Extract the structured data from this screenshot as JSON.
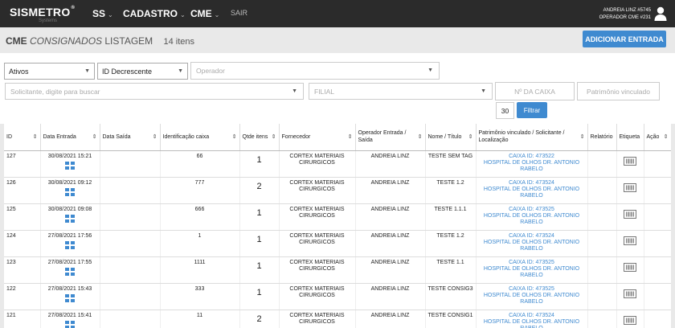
{
  "navbar": {
    "brand": "SISMETRO",
    "brand_sup": "®",
    "brand_sub": "Systems",
    "menu": [
      {
        "label": "SS"
      },
      {
        "label": "CADASTRO"
      },
      {
        "label": "CME"
      }
    ],
    "sair": "SAIR",
    "user_line1": "ANDREIA LINZ #5745",
    "user_line2": "OPERADOR CME #231"
  },
  "header": {
    "title_bold": "CME",
    "title_italic": "CONSIGNADOS",
    "title_rest": "LISTAGEM",
    "count": "14 itens",
    "add_button": "ADICIONAR ENTRADA"
  },
  "filters": {
    "status": "Ativos",
    "order": "ID Decrescente",
    "operador_placeholder": "Operador",
    "solicitante_placeholder": "Solicitante, digite para buscar",
    "filial_placeholder": "FILIAL",
    "caixa_placeholder": "Nº DA CAIXA",
    "patrimonio_placeholder": "Patrimônio vinculado",
    "page_size": "30",
    "filter_button": "Filtrar"
  },
  "table": {
    "headers": [
      "ID",
      "Data Entrada",
      "Data Saída",
      "Identificação caixa",
      "Qtde itens",
      "Fornecedor",
      "Operador Entrada / Saída",
      "Nome / Título",
      "Patrimônio vinculado / Solicitante / Localização",
      "Relatório",
      "Etiqueta",
      "Ação"
    ],
    "rows": [
      {
        "id": "127",
        "data_entrada": "30/08/2021 15:21",
        "data_saida": "",
        "caixa": "66",
        "qtde": "1",
        "fornecedor": "CORTEX MATERIAIS CIRURGICOS",
        "operador": "ANDREIA LINZ",
        "nome": "TESTE SEM TAG",
        "patrimonio": "CAIXA ID: 473522",
        "local": "HOSPITAL DE OLHOS DR. ANTONIO RABELO"
      },
      {
        "id": "126",
        "data_entrada": "30/08/2021 09:12",
        "data_saida": "",
        "caixa": "777",
        "qtde": "2",
        "fornecedor": "CORTEX MATERIAIS CIRURGICOS",
        "operador": "ANDREIA LINZ",
        "nome": "TESTE 1.2",
        "patrimonio": "CAIXA ID: 473524",
        "local": "HOSPITAL DE OLHOS DR. ANTONIO RABELO"
      },
      {
        "id": "125",
        "data_entrada": "30/08/2021 09:08",
        "data_saida": "",
        "caixa": "666",
        "qtde": "1",
        "fornecedor": "CORTEX MATERIAIS CIRURGICOS",
        "operador": "ANDREIA LINZ",
        "nome": "TESTE 1.1.1",
        "patrimonio": "CAIXA ID: 473525",
        "local": "HOSPITAL DE OLHOS DR. ANTONIO RABELO"
      },
      {
        "id": "124",
        "data_entrada": "27/08/2021 17:56",
        "data_saida": "",
        "caixa": "1",
        "qtde": "1",
        "fornecedor": "CORTEX MATERIAIS CIRURGICOS",
        "operador": "ANDREIA LINZ",
        "nome": "TESTE 1.2",
        "patrimonio": "CAIXA ID: 473524",
        "local": "HOSPITAL DE OLHOS DR. ANTONIO RABELO"
      },
      {
        "id": "123",
        "data_entrada": "27/08/2021 17:55",
        "data_saida": "",
        "caixa": "1111",
        "qtde": "1",
        "fornecedor": "CORTEX MATERIAIS CIRURGICOS",
        "operador": "ANDREIA LINZ",
        "nome": "TESTE 1.1",
        "patrimonio": "CAIXA ID: 473525",
        "local": "HOSPITAL DE OLHOS DR. ANTONIO RABELO"
      },
      {
        "id": "122",
        "data_entrada": "27/08/2021 15:43",
        "data_saida": "",
        "caixa": "333",
        "qtde": "1",
        "fornecedor": "CORTEX MATERIAIS CIRURGICOS",
        "operador": "ANDREIA LINZ",
        "nome": "TESTE CONSIG3",
        "patrimonio": "CAIXA ID: 473525",
        "local": "HOSPITAL DE OLHOS DR. ANTONIO RABELO"
      },
      {
        "id": "121",
        "data_entrada": "27/08/2021 15:41",
        "data_saida": "",
        "caixa": "11",
        "qtde": "2",
        "fornecedor": "CORTEX MATERIAIS CIRURGICOS",
        "operador": "ANDREIA LINZ",
        "nome": "TESTE CONSIG1",
        "patrimonio": "CAIXA ID: 473524",
        "local": "HOSPITAL DE OLHOS DR. ANTONIO RABELO"
      }
    ]
  },
  "icons": {
    "detail_icon": "grid-plus-icon",
    "tag_icon": "barcode-label-icon",
    "user_icon": "user-icon"
  },
  "colors": {
    "navbar": "#2b2b2b",
    "accent": "#3f8ad0",
    "link": "#3f8ad0"
  }
}
